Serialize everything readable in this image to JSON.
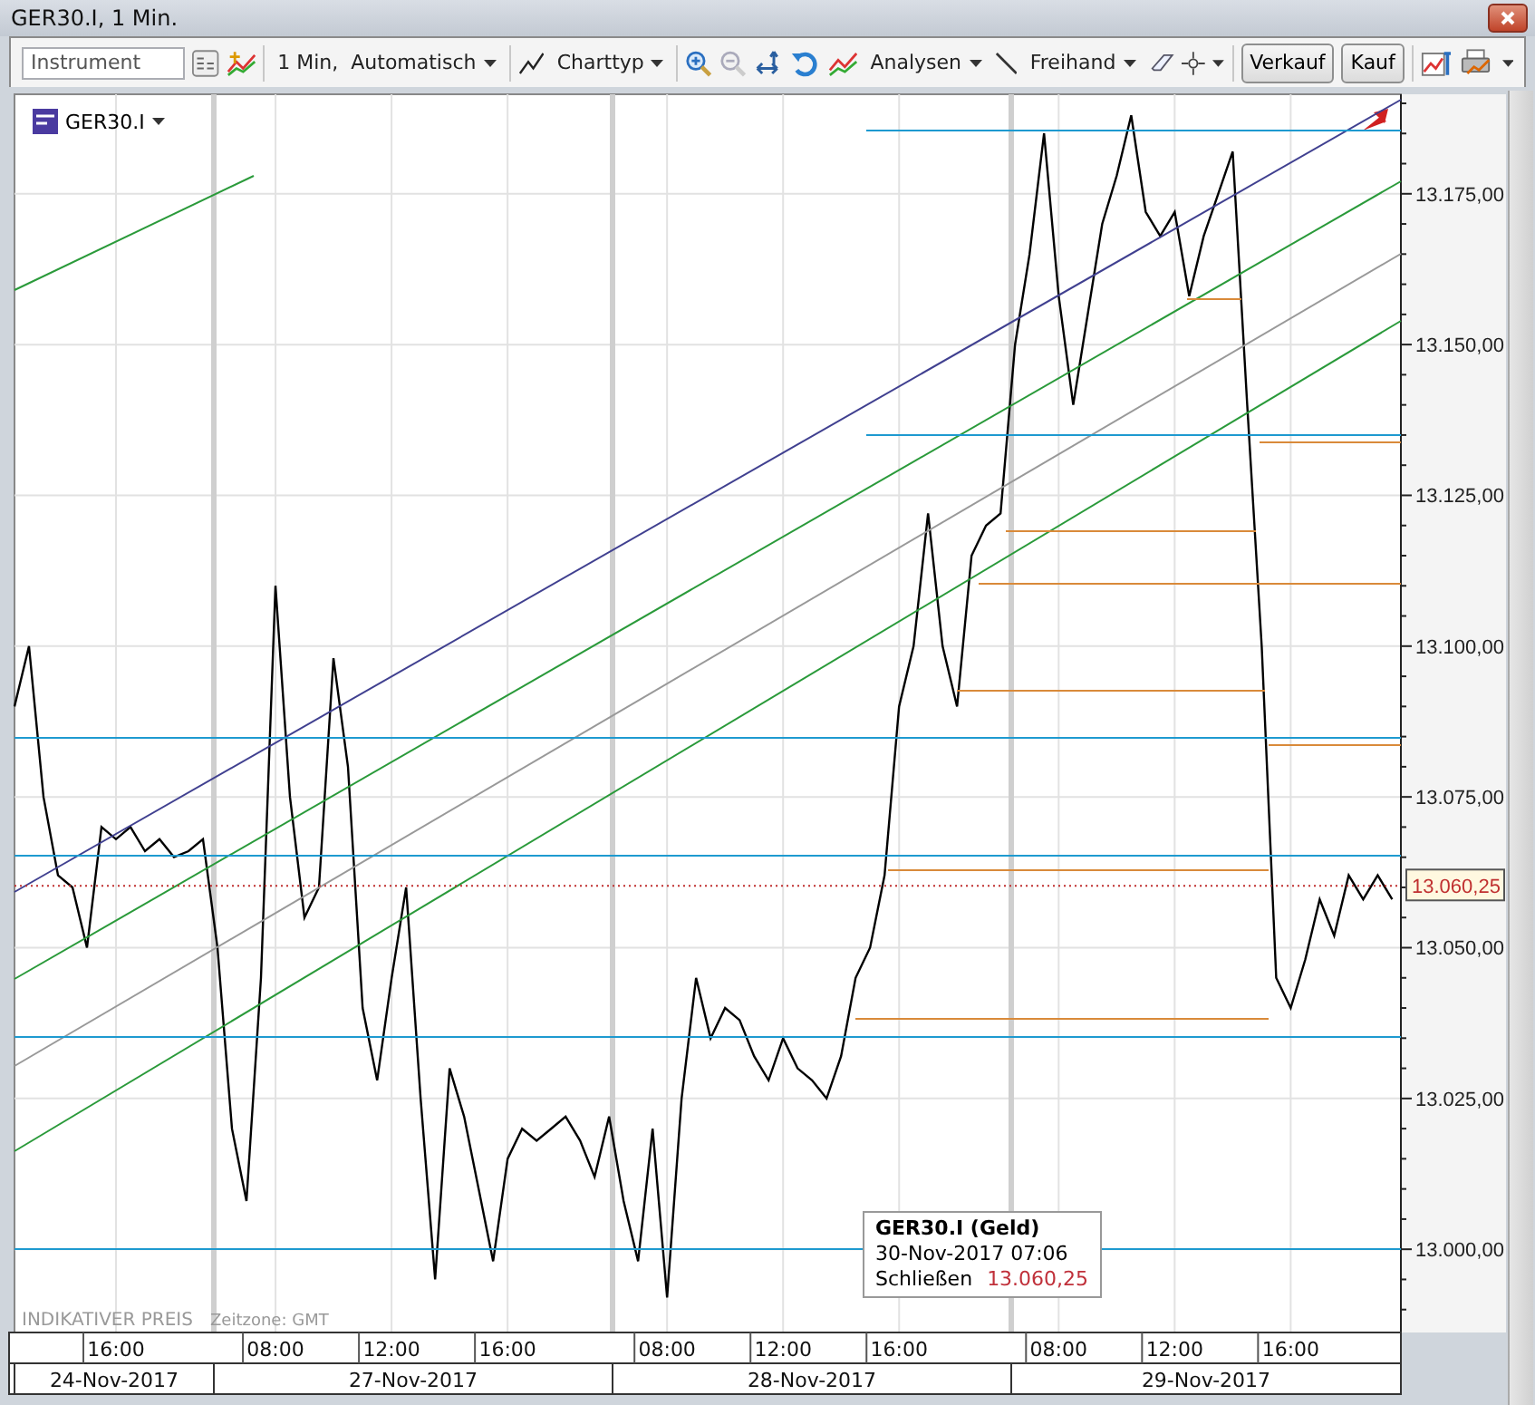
{
  "window": {
    "title": "GER30.I, 1 Min."
  },
  "toolbar": {
    "instrument_field": {
      "placeholder": "Instrument"
    },
    "interval_menu": "1 Min,  Automatisch",
    "chart_type_menu": "Charttyp",
    "analysis_menu": "Analysen",
    "freehand_menu": "Freihand",
    "buttons": [
      "Verkauf",
      "Kauf"
    ]
  },
  "chart": {
    "current_price_label": "13.060,25",
    "footer_note": "INDIKATIVER PREIS",
    "timezone": "Zeitzone: GMT",
    "dates": [
      "24-Nov-2017",
      "27-Nov-2017",
      "28-Nov-2017",
      "29-Nov-2017"
    ],
    "tooltip": {
      "title": "GER30.I (Geld)",
      "time": "30-Nov-2017 07:06",
      "label": "Schließen",
      "value": "13.060,25"
    },
    "chart_data": {
      "type": "line",
      "categories": [
        null,
        null,
        null,
        null,
        null,
        null,
        null,
        "16:00",
        null,
        null,
        null,
        null,
        null,
        null,
        null,
        null,
        null,
        null,
        "08:00",
        null,
        null,
        null,
        null,
        null,
        null,
        null,
        "12:00",
        null,
        null,
        null,
        null,
        null,
        null,
        null,
        "16:00",
        null,
        null,
        null,
        null,
        null,
        null,
        null,
        null,
        null,
        null,
        "08:00",
        null,
        null,
        null,
        null,
        null,
        null,
        null,
        "12:00",
        null,
        null,
        null,
        null,
        null,
        null,
        null,
        "16:00",
        null,
        null,
        null,
        null,
        null,
        null,
        null,
        null,
        null,
        null,
        "08:00",
        null,
        null,
        null,
        null,
        null,
        null,
        null,
        "12:00",
        null,
        null,
        null,
        null,
        null,
        null,
        null,
        "16:00",
        null,
        null,
        null,
        null,
        null,
        null,
        null
      ],
      "series": [
        {
          "name": "GER30.I",
          "color": "#000000",
          "values": [
            13090,
            13100,
            13075,
            13062,
            13060,
            13050,
            13070,
            13068,
            13070,
            13066,
            13068,
            13065,
            13066,
            13068,
            13050,
            13020,
            13008,
            13045,
            13110,
            13075,
            13055,
            13060,
            13098,
            13080,
            13040,
            13028,
            13045,
            13060,
            13025,
            12995,
            13030,
            13022,
            13010,
            12998,
            13015,
            13020,
            13018,
            13020,
            13022,
            13018,
            13012,
            13022,
            13008,
            12998,
            13020,
            12992,
            13025,
            13045,
            13035,
            13040,
            13038,
            13032,
            13028,
            13035,
            13030,
            13028,
            13025,
            13032,
            13045,
            13050,
            13062,
            13090,
            13100,
            13122,
            13100,
            13090,
            13115,
            13120,
            13122,
            13150,
            13165,
            13185,
            13158,
            13140,
            13155,
            13170,
            13178,
            13188,
            13172,
            13168,
            13172,
            13158,
            13168,
            13175,
            13182,
            13140,
            13100,
            13045,
            13040,
            13048,
            13058,
            13052,
            13062,
            13058,
            13062,
            13058
          ]
        }
      ],
      "ylim": [
        12986.2,
        13191.5
      ],
      "yticks": [
        {
          "value": 13000,
          "label": "13.000,00"
        },
        {
          "value": 13025,
          "label": "13.025,00"
        },
        {
          "value": 13050,
          "label": "13.050,00"
        },
        {
          "value": 13075,
          "label": "13.075,00"
        },
        {
          "value": 13100,
          "label": "13.100,00"
        },
        {
          "value": 13125,
          "label": "13.125,00"
        },
        {
          "value": 13150,
          "label": "13.150,00"
        },
        {
          "value": 13175,
          "label": "13.175,00"
        }
      ],
      "grid": true
    }
  }
}
